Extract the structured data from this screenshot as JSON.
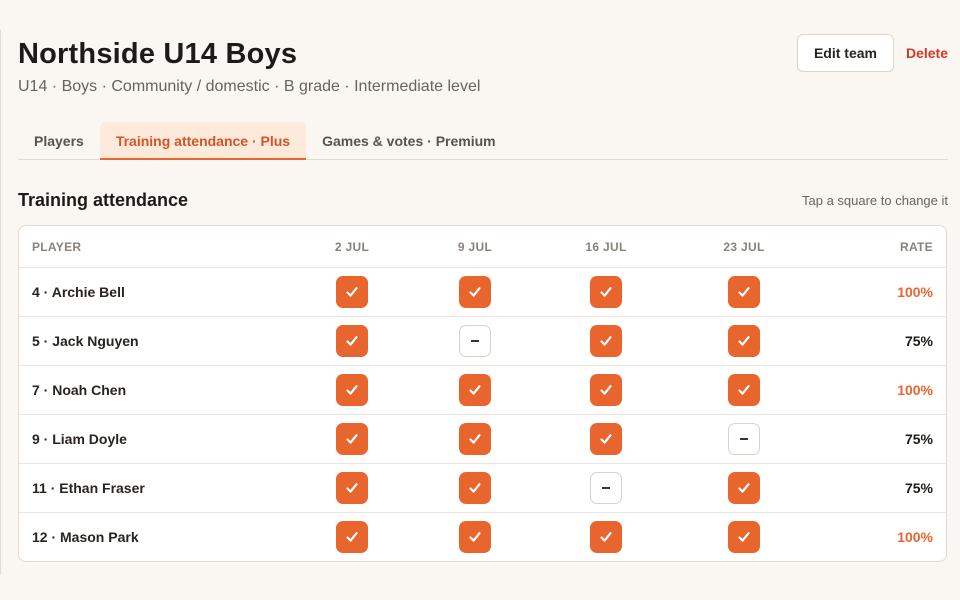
{
  "team": {
    "title": "Northside U14 Boys",
    "meta": "U14 · Boys · Community / domestic · B grade · Intermediate level",
    "edit_label": "Edit team",
    "delete_label": "Delete"
  },
  "tabs": [
    {
      "label": "Players",
      "active": false
    },
    {
      "label": "Training attendance · Plus",
      "active": true
    },
    {
      "label": "Games & votes · Premium",
      "active": false
    }
  ],
  "section": {
    "title": "Training attendance",
    "hint": "Tap a square to change it"
  },
  "table": {
    "headers": {
      "player": "PLAYER",
      "dates": [
        "2 JUL",
        "9 JUL",
        "16 JUL",
        "23 JUL"
      ],
      "rate": "RATE"
    },
    "rows": [
      {
        "player": "4 · Archie Bell",
        "attendance": [
          true,
          true,
          true,
          true
        ],
        "rate": "100%"
      },
      {
        "player": "5 · Jack Nguyen",
        "attendance": [
          true,
          false,
          true,
          true
        ],
        "rate": "75%"
      },
      {
        "player": "7 · Noah Chen",
        "attendance": [
          true,
          true,
          true,
          true
        ],
        "rate": "100%"
      },
      {
        "player": "9 · Liam Doyle",
        "attendance": [
          true,
          true,
          true,
          false
        ],
        "rate": "75%"
      },
      {
        "player": "11 · Ethan Fraser",
        "attendance": [
          true,
          true,
          false,
          true
        ],
        "rate": "75%"
      },
      {
        "player": "12 · Mason Park",
        "attendance": [
          true,
          true,
          true,
          true
        ],
        "rate": "100%"
      }
    ]
  },
  "colors": {
    "accent": "#e8652e",
    "delete": "#d4382c",
    "tab_active_bg": "#fdeadb"
  },
  "icons": {
    "present": "check-icon",
    "absent": "dash-icon"
  }
}
